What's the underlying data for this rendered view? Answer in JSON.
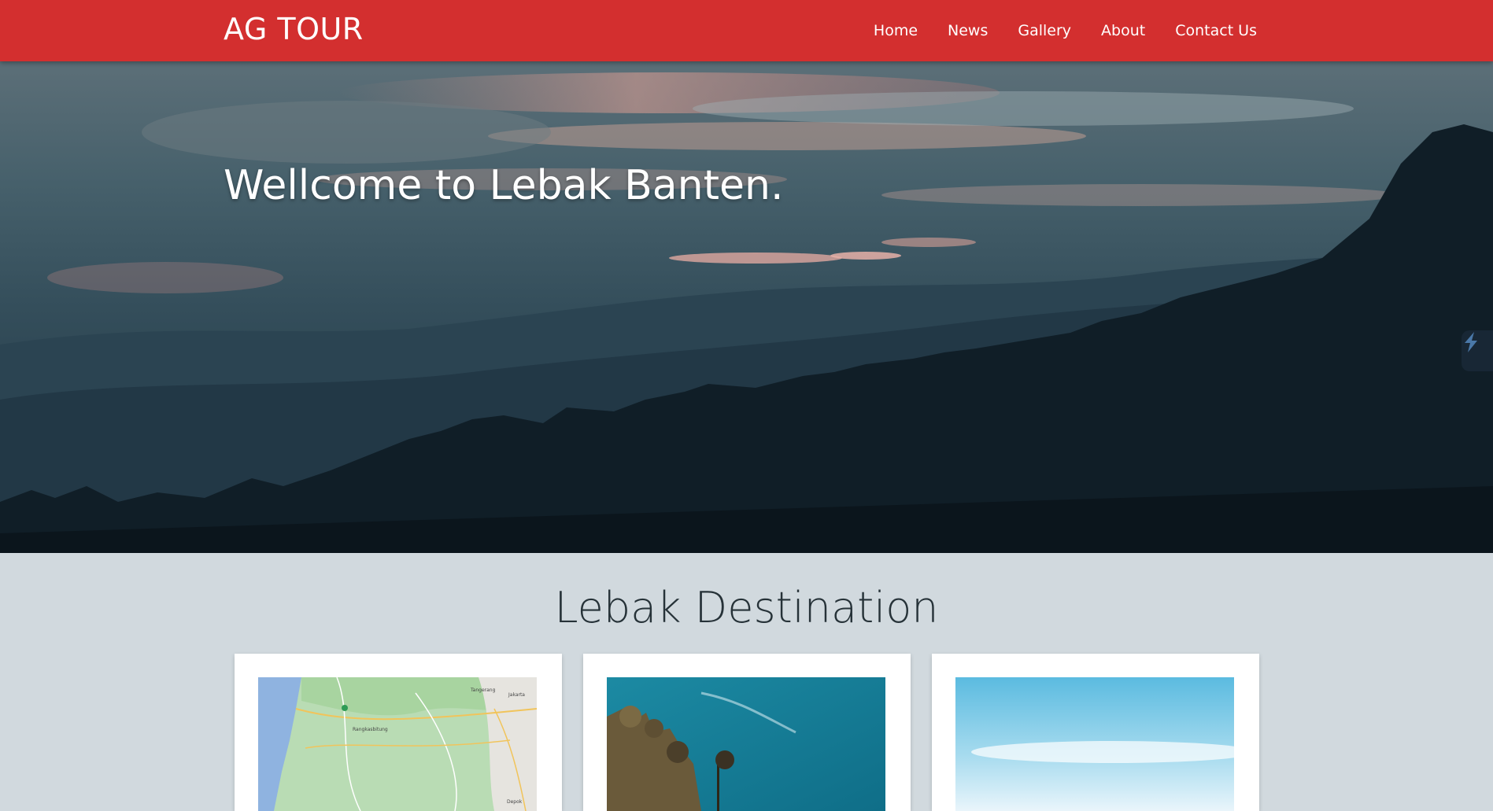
{
  "nav": {
    "brand": "AG TOUR",
    "links": [
      "Home",
      "News",
      "Gallery",
      "About",
      "Contact Us"
    ]
  },
  "hero": {
    "title": "Wellcome to Lebak Banten."
  },
  "section": {
    "title": "Lebak Destination"
  },
  "map_labels": {
    "tangerang": "Tangerang",
    "jakarta": "Jakarta",
    "rangkasbitung": "Rangkasbitung",
    "depok": "Depok"
  },
  "colors": {
    "navbar": "#d32f2f",
    "background": "#d1d9de",
    "card": "#ffffff"
  },
  "icons": {
    "side_tab": "extension-bolt-icon"
  }
}
